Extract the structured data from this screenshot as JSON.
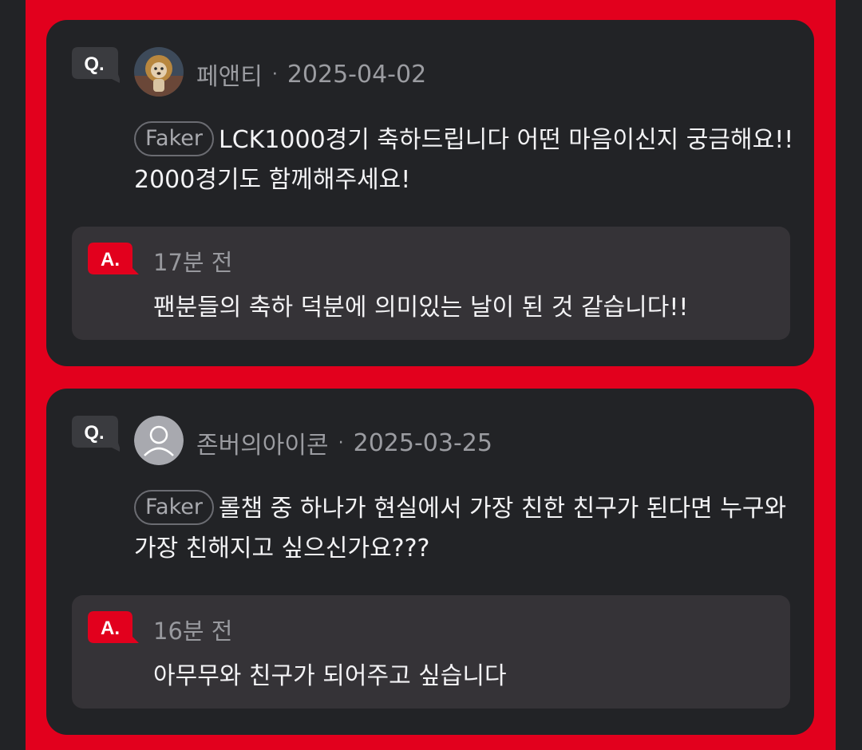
{
  "cards": [
    {
      "q_badge": "Q.",
      "avatar_icon": "lion-dog-photo-avatar",
      "author": "페앤티",
      "separator": "·",
      "date": "2025-04-02",
      "tag": "Faker",
      "question": "LCK1000경기 축하드립니다 어떤 마음이신지 궁금해요!! 2000경기도 함께해주세요!",
      "a_badge": "A.",
      "answer_time": "17분 전",
      "answer": "팬분들의 축하 덕분에 의미있는 날이 된 것 같습니다!!"
    },
    {
      "q_badge": "Q.",
      "avatar_icon": "default-user-icon",
      "author": "존버의아이콘",
      "separator": "·",
      "date": "2025-03-25",
      "tag": "Faker",
      "question": "롤챔 중 하나가 현실에서 가장 친한 친구가 된다면 누구와 가장 친해지고 싶으신가요???",
      "a_badge": "A.",
      "answer_time": "16분 전",
      "answer": "아무무와 친구가 되어주고 싶습니다"
    }
  ],
  "colors": {
    "brand_red": "#e2001d",
    "card_bg": "#222326",
    "answer_bg": "#353337",
    "q_badge_bg": "#3a3b3f"
  }
}
